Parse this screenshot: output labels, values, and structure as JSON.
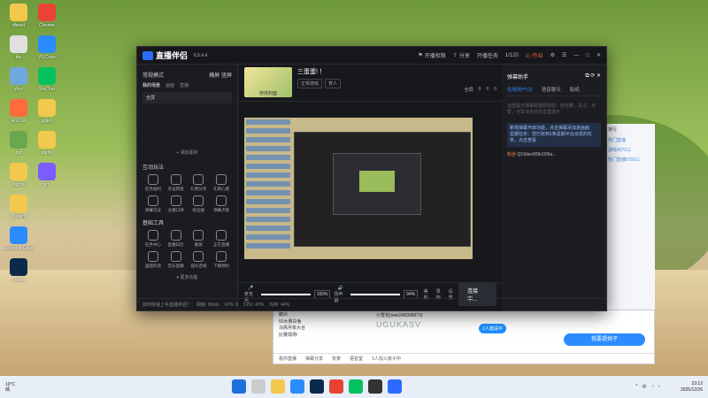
{
  "desktop": {
    "icons": [
      {
        "label": "dlwnld",
        "color": "#f2c94c"
      },
      {
        "label": "bin",
        "color": "#e0e0e0"
      },
      {
        "label": "yhyz",
        "color": "#6fa8dc"
      },
      {
        "label": "AGVSF",
        "color": "#ff6b3d"
      },
      {
        "label": "dgf",
        "color": "#6aa84f"
      },
      {
        "label": "ngchr",
        "color": "#f2c94c"
      },
      {
        "label": "shroom",
        "color": "#f2c94c"
      },
      {
        "label": "Microsoft Edge",
        "color": "#2b8cff"
      },
      {
        "label": "Steam",
        "color": "#0b2a4a"
      },
      {
        "label": "Chrome",
        "color": "#ea4335"
      },
      {
        "label": "VS Code",
        "color": "#2b8cff"
      },
      {
        "label": "WeChat",
        "color": "#07c160"
      },
      {
        "label": "ggtrn",
        "color": "#f2c94c"
      },
      {
        "label": "dgpbr",
        "color": "#f2c94c"
      },
      {
        "label": "gm",
        "color": "#7a5cff"
      }
    ]
  },
  "app": {
    "name": "直播伴侣",
    "version": "6.5.4.4",
    "titlebar_buttons": [
      "开播权限",
      "分享"
    ],
    "right_titlebar": [
      "开播任务",
      "1/120",
      "心 作业"
    ],
    "left": {
      "mode_title": "常规模式",
      "mode_tabs": [
        "横屏",
        "竖屏"
      ],
      "scene_section": "我的场景",
      "scene_tabs": [
        "画面",
        "直播"
      ],
      "scene_item": "全屏",
      "add_material": "+ 添加素材",
      "interact_title": "互动玩法",
      "interact_tools": [
        "任务福利",
        "幸运转盘",
        "礼物分享",
        "礼物心愿",
        "弹幕玩法",
        "主播口碑",
        "粉丝群",
        "弹幕点歌"
      ],
      "basic_title": "基础工具",
      "basic_tools": [
        "任务中心",
        "直播日历",
        "截屏",
        "正在直播",
        "画面检测",
        "音乐直播",
        "观众连线",
        "下播预约"
      ],
      "more": "▾ 更多功能"
    },
    "stream": {
      "title": "三蛋蛋! ！",
      "thumb_caption": "修改封面",
      "tags": [
        "正常游戏",
        "育人"
      ],
      "stats": [
        "全屏",
        "0",
        "0",
        "0"
      ]
    },
    "mixer": {
      "mic_label": "麦克风",
      "mic_value": "100%",
      "speaker_label": "扬声器",
      "speaker_value": "94%",
      "buttons": [
        "美颜",
        "录制",
        "设置"
      ],
      "start": "连接中..."
    },
    "statusbar": [
      "如何快速上手直播伴侣？",
      "网络: 0Kb/s",
      "FPS: 0",
      "CPU: 47%",
      "内存: 44%"
    ],
    "right_panel": {
      "tabs": [
        "开播任务",
        "1/120",
        "心 作业"
      ],
      "section": "弹幕助手",
      "subtabs": [
        "在线用户(2)",
        "语音聊天",
        "贴纸"
      ],
      "tip": "运营提示弹幕助理帮助您，粉丝数，关注，点赞，分享消息将在这里展示",
      "notice": "新增弹幕开启功能，点击弹幕添加进画面",
      "notice2": "星期任务：您已收到1条星期平台派发的任务，点击查看",
      "chat_name": "粉丝",
      "chat_text": "Q19dex6f9b15f9a..."
    }
  },
  "side_window": {
    "tab": "排行",
    "links": [
      "热门直播",
      "游戏4270三",
      "热门直播5750三"
    ]
  },
  "chat_window": {
    "list": [
      "鹏兴",
      "小雪花(owo246398973)",
      "50大赛白兔",
      "马扬月俊大合",
      "比赛现场!"
    ],
    "code": "UGUKASV",
    "pill": "1人邀请中",
    "button": "我要提挑子",
    "bar": [
      "看你直播",
      "弹幕分享",
      "背景",
      "语音室",
      "1人加入房子中"
    ]
  },
  "taskbar": {
    "weather_temp": "10°C",
    "weather_desc": "晴",
    "time": "23:12",
    "date": "2025/12/26"
  }
}
